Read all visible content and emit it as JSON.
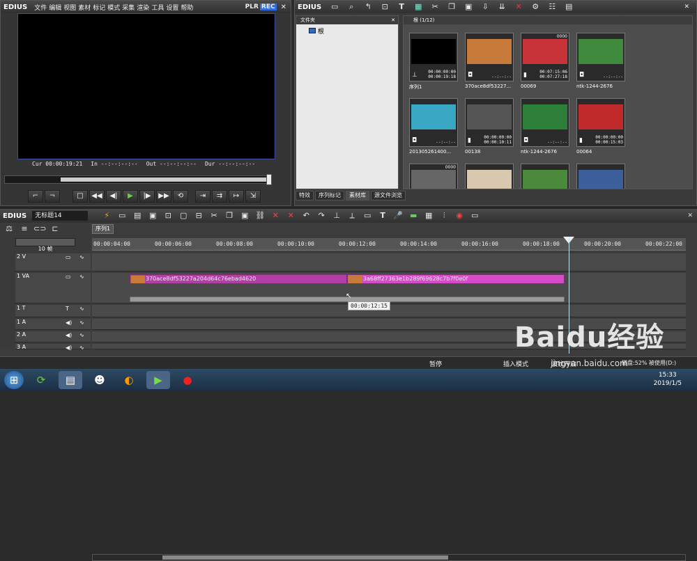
{
  "app": {
    "name": "EDIUS"
  },
  "player": {
    "menu": [
      "文件",
      "编辑",
      "视图",
      "素材",
      "标记",
      "模式",
      "采集",
      "渲染",
      "工具",
      "设置",
      "帮助"
    ],
    "mode_plr": "PLR",
    "mode_rec": "REC",
    "close": "✕",
    "timecodes": {
      "cur_label": "Cur",
      "cur_value": "00:00:19:21",
      "in_label": "In",
      "in_value": "--:--:--:--",
      "out_label": "Out",
      "out_value": "--:--:--:--",
      "dur_label": "Dur",
      "dur_value": "--:--:--:--"
    }
  },
  "bin": {
    "title": "EDIUS",
    "folder_header": "文件夹",
    "root_label": "根",
    "clips_header": "根 (1/12)",
    "clips": [
      {
        "name": "序列1",
        "tc1": "00:00:00:00",
        "tc2": "00:00:19:18",
        "num": "",
        "type": "sequence",
        "color": "#000000"
      },
      {
        "name": "370ace8df53227...",
        "tc1": "--:--:--",
        "tc2": "",
        "num": "",
        "type": "still",
        "color": "#c77a3a"
      },
      {
        "name": "00069",
        "tc1": "00:07:15:06",
        "tc2": "00:07:27:18",
        "num": "0000",
        "type": "video",
        "color": "#c9333a"
      },
      {
        "name": "ntk-1244-2676",
        "tc1": "--:--:--",
        "tc2": "",
        "num": "",
        "type": "still",
        "color": "#3f8a3c"
      },
      {
        "name": "201305261400...",
        "tc1": "--:--:--",
        "tc2": "",
        "num": "",
        "type": "still",
        "color": "#39a6c4"
      },
      {
        "name": "00138",
        "tc1": "00:00:00:00",
        "tc2": "00:00:10:11",
        "num": "",
        "type": "video",
        "color": "#555555"
      },
      {
        "name": "ntk-1244-2676",
        "tc1": "--:--:--",
        "tc2": "",
        "num": "",
        "type": "still",
        "color": "#2e7f3a"
      },
      {
        "name": "00064",
        "tc1": "00:00:00:00",
        "tc2": "00:00:15:03",
        "num": "",
        "type": "video",
        "color": "#c02a2a"
      }
    ],
    "row3_thumbs": [
      {
        "num": "0000",
        "color": "#666666"
      },
      {
        "num": "",
        "color": "#d8c8b0"
      },
      {
        "num": "",
        "color": "#4a8a3a"
      },
      {
        "num": "",
        "color": "#3a5f9a"
      }
    ],
    "tabs": [
      "特效",
      "序列标记",
      "素材库",
      "源文件浏览"
    ]
  },
  "timeline": {
    "project_title": "无标题14",
    "sequence_tab": "序列1",
    "zoom": "10 帧",
    "ruler": [
      "00:00:04:00",
      "00:00:06:00",
      "00:00:08:00",
      "00:00:10:00",
      "00:00:12:00",
      "00:00:14:00",
      "00:00:16:00",
      "00:00:18:00",
      "00:00:20:00",
      "00:00:22:00"
    ],
    "tracks": [
      "2 V",
      "1 VA",
      "1 T",
      "1 A",
      "2 A",
      "3 A"
    ],
    "clip1": "370ace8df53227a204d64c76ebad4620",
    "clip2": "3a68ff27363e1b289f69628c7b7f0e0f",
    "tooltip": "00:00:12:15"
  },
  "status": {
    "pause": "暂停",
    "insert": "插入模式",
    "ripple": "波纹开启",
    "disk": "磁盘:52% 被使用(D:)"
  },
  "taskbar": {
    "time": "15:33",
    "date": "2019/1/5"
  },
  "watermark": {
    "brand": "Baidu经验",
    "url": "jingyan.baidu.com"
  }
}
